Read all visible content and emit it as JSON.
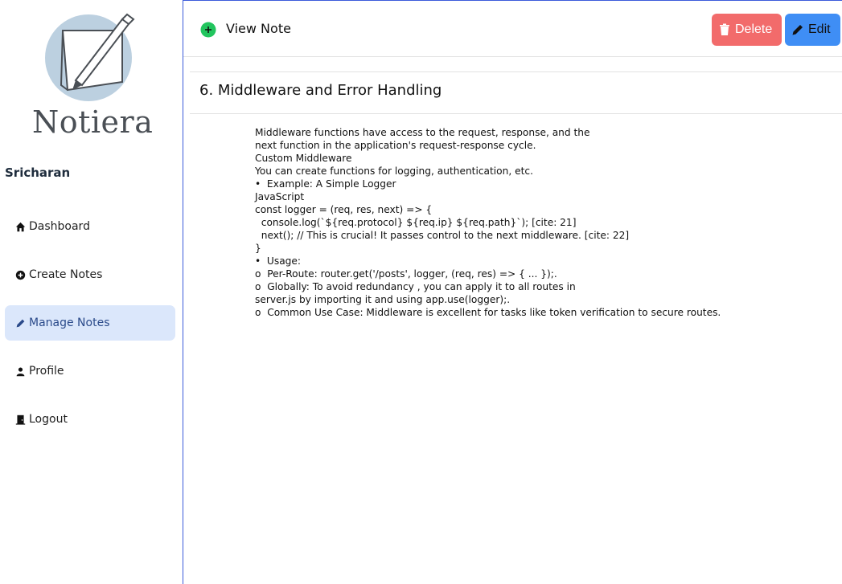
{
  "app": {
    "logo_text": "Notiera",
    "username": "Sricharan"
  },
  "sidebar": {
    "items": [
      {
        "label": "Dashboard",
        "icon": "home-icon",
        "active": false
      },
      {
        "label": "Create Notes",
        "icon": "plus-circle-icon",
        "active": false
      },
      {
        "label": "Manage Notes",
        "icon": "pencil-icon",
        "active": true
      },
      {
        "label": "Profile",
        "icon": "user-icon",
        "active": false
      },
      {
        "label": "Logout",
        "icon": "door-icon",
        "active": false
      }
    ]
  },
  "header": {
    "title": "View Note",
    "icon": "plus-circle-icon",
    "delete_label": "Delete",
    "edit_label": "Edit"
  },
  "note": {
    "title": "6. Middleware and Error Handling",
    "lines": [
      "Middleware functions have access to the request, response, and the",
      "next function in the application's request-response cycle.",
      "Custom Middleware",
      "You can create functions for logging, authentication, etc.",
      "•  Example: A Simple Logger",
      "JavaScript",
      "const logger = (req, res, next) => {",
      "  console.log(`${req.protocol} ${req.ip} ${req.path}`); [cite: 21]",
      "  next(); // This is crucial! It passes control to the next middleware. [cite: 22]",
      "}",
      "•  Usage:",
      "o  Per-Route: router.get('/posts', logger, (req, res) => { ... });.",
      "o  Globally: To avoid redundancy , you can apply it to all routes in",
      "server.js by importing it and using app.use(logger);.",
      "o  Common Use Case: Middleware is excellent for tasks like token verification to secure routes."
    ]
  },
  "colors": {
    "accent": "#3b5bdb",
    "active_bg": "#dbe7fb",
    "delete_bg": "#f26b6b",
    "edit_bg": "#3f8ef5",
    "header_icon": "#22c55e"
  }
}
